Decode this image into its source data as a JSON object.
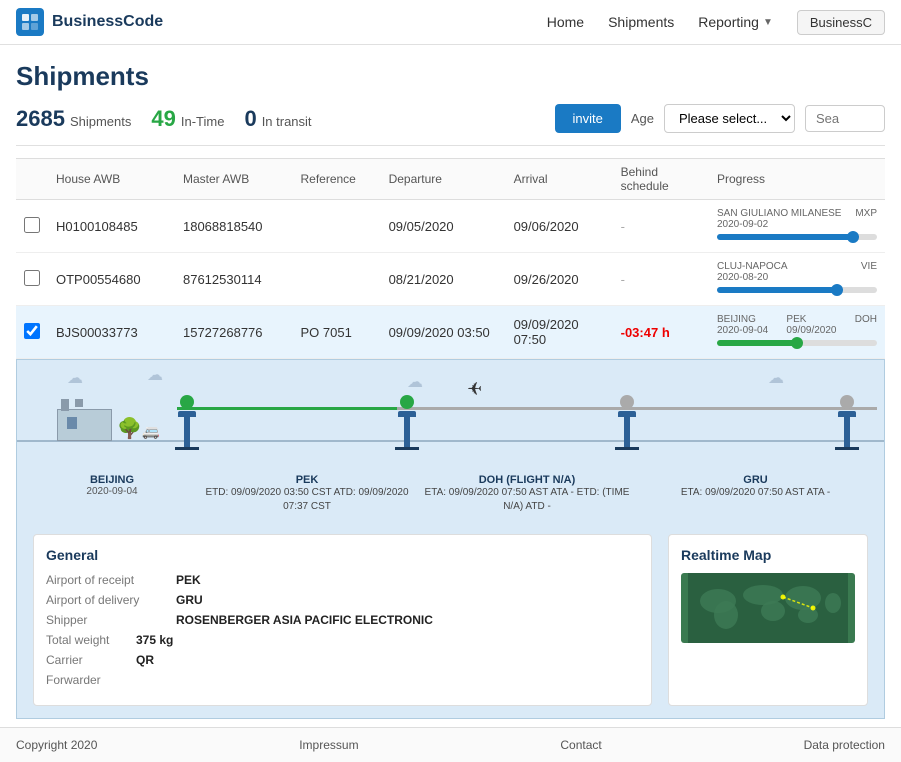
{
  "brand": {
    "icon": "BC",
    "name": "BusinessCode"
  },
  "nav": {
    "home": "Home",
    "shipments": "Shipments",
    "reporting": "Reporting",
    "user": "BusinessC"
  },
  "page": {
    "title": "Shipments"
  },
  "stats": {
    "count": "2685",
    "count_label": "Shipments",
    "intime": "49",
    "intime_label": "In-Time",
    "intransit": "0",
    "intransit_label": "In transit",
    "invite_label": "invite",
    "age_label": "Age",
    "please_select": "Please select...",
    "search_placeholder": "Sea"
  },
  "table": {
    "headers": [
      "",
      "House AWB",
      "Master AWB",
      "Reference",
      "Departure",
      "Arrival",
      "Behind schedule",
      "Progress"
    ],
    "rows": [
      {
        "id": "row1",
        "house_awb": "H0100108485",
        "master_awb": "18068818540",
        "reference": "",
        "departure": "09/05/2020",
        "arrival": "09/06/2020",
        "behind": "-",
        "progress_from": "SAN GIULIANO MILANESE",
        "progress_from_date": "2020-09-02",
        "progress_to": "MXP",
        "progress_pct": 85,
        "progress_color": "blue"
      },
      {
        "id": "row2",
        "house_awb": "OTP00554680",
        "master_awb": "87612530114",
        "reference": "",
        "departure": "08/21/2020",
        "arrival": "09/26/2020",
        "behind": "-",
        "progress_from": "CLUJ-NAPOCA",
        "progress_from_date": "2020-08-20",
        "progress_to": "VIE",
        "progress_pct": 75,
        "progress_color": "blue"
      },
      {
        "id": "row3",
        "house_awb": "BJS00033773",
        "master_awb": "15727268776",
        "reference": "PO 7051",
        "departure": "09/09/2020 03:50",
        "arrival": "09/09/2020 07:50",
        "behind": "-03:47 h",
        "progress_from": "BEIJING",
        "progress_from_date": "2020-09-04",
        "progress_to": "PEK",
        "progress_to_date": "09/09/2020",
        "progress_to_extra": "DOH",
        "progress_pct": 50,
        "progress_color": "green",
        "selected": true
      }
    ]
  },
  "expanded": {
    "stations": [
      {
        "name": "BEIJING",
        "date": "2020-09-04",
        "etd": "",
        "type": "origin"
      },
      {
        "name": "PEK",
        "date": "",
        "etd": "ETD: 09/09/2020 03:50 CST ATD: 09/09/2020 07:37 CST",
        "type": "waypoint"
      },
      {
        "name": "DOH (FLIGHT N/A)",
        "date": "",
        "etd": "ETA: 09/09/2020 07:50 AST ATA - ETD: (TIME N/A) ATD -",
        "type": "waypoint"
      },
      {
        "name": "GRU",
        "date": "",
        "etd": "ETA: 09/09/2020 07:50 AST ATA -",
        "type": "destination"
      }
    ]
  },
  "general": {
    "title": "General",
    "airport_receipt_label": "Airport of receipt",
    "airport_receipt_value": "PEK",
    "airport_delivery_label": "Airport of delivery",
    "airport_delivery_value": "GRU",
    "shipper_label": "Shipper",
    "shipper_value": "ROSENBERGER ASIA PACIFIC ELECTRONIC",
    "total_weight_label": "Total weight",
    "total_weight_value": "375 kg",
    "carrier_label": "Carrier",
    "carrier_value": "QR",
    "forwarder_label": "Forwarder",
    "forwarder_value": ""
  },
  "map": {
    "title": "Realtime Map"
  },
  "footer": {
    "copyright": "Copyright 2020",
    "impressum": "Impressum",
    "contact": "Contact",
    "data_protection": "Data protection"
  }
}
